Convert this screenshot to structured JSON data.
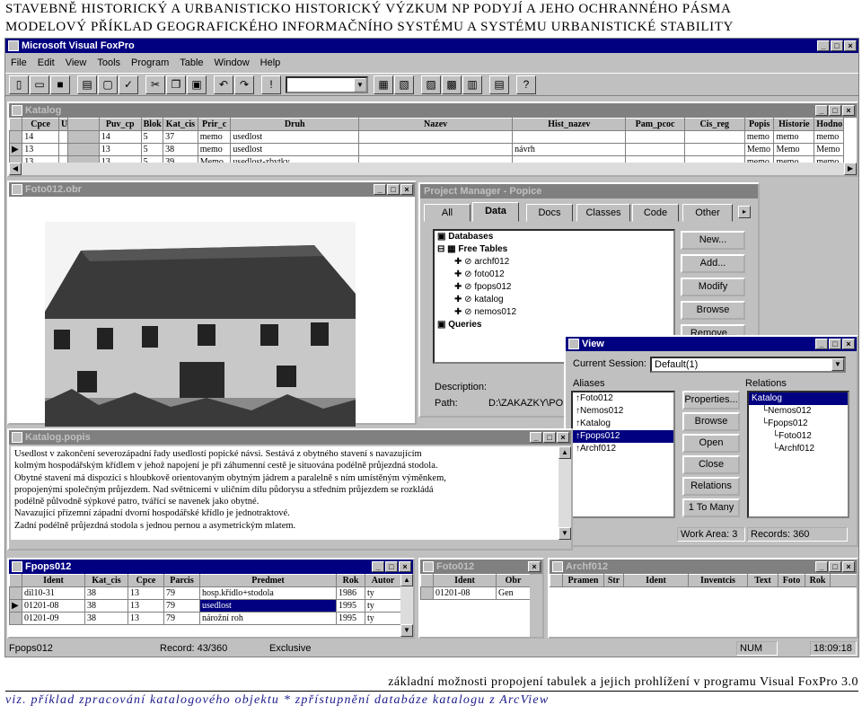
{
  "header": {
    "line1": "STAVEBNĚ HISTORICKÝ A URBANISTICKO HISTORICKÝ VÝZKUM NP PODYJÍ A JEHO OCHRANNÉHO PÁSMA",
    "line2": "MODELOVÝ PŘÍKLAD GEOGRAFICKÉHO INFORMAČNÍHO SYSTÉMU A SYSTÉMU URBANISTICKÉ STABILITY"
  },
  "app": {
    "title": "Microsoft Visual FoxPro"
  },
  "menu": [
    "File",
    "Edit",
    "View",
    "Tools",
    "Program",
    "Table",
    "Window",
    "Help"
  ],
  "katalog": {
    "title": "Katalog",
    "columns": [
      "Cpce",
      "U",
      "Puv_cp",
      "Blok",
      "Kat_cis",
      "Prir_c",
      "Druh",
      "Nazev",
      "Hist_nazev",
      "Pam_pcoc",
      "Cis_reg",
      "Popis",
      "Historie",
      "Hodno"
    ],
    "rows": [
      [
        "14",
        "",
        "14",
        "5",
        "37",
        "memo",
        "usedlost",
        "",
        "",
        "",
        "",
        "memo",
        "memo",
        "memo"
      ],
      [
        "13",
        "",
        "13",
        "5",
        "38",
        "memo",
        "usedlost",
        "",
        "návrh",
        "",
        "",
        "Memo",
        "Memo",
        "Memo"
      ],
      [
        "13",
        "",
        "13",
        "5",
        "39",
        "Memo",
        "usedlost-zbytky",
        "",
        "",
        "",
        "",
        "memo",
        "memo",
        "memo"
      ]
    ]
  },
  "foto": {
    "title": "Foto012.obr"
  },
  "project": {
    "title": "Project Manager - Popice",
    "tabs": [
      "All",
      "Data",
      "Docs",
      "Classes",
      "Code",
      "Other"
    ],
    "tree": [
      "Databases",
      "Free Tables",
      "archf012",
      "foto012",
      "fpops012",
      "katalog",
      "nemos012",
      "Queries"
    ],
    "buttons": [
      "New...",
      "Add...",
      "Modify",
      "Browse",
      "Remove..."
    ],
    "description_label": "Description:",
    "path_label": "Path:",
    "path_value": "D:\\ZAKAZKY\\POD"
  },
  "view": {
    "title": "View",
    "session_label": "Current Session:",
    "session_value": "Default(1)",
    "aliases_label": "Aliases",
    "relations_label": "Relations",
    "aliases": [
      "Foto012",
      "Nemos012",
      "Katalog",
      "Fpops012",
      "Archf012"
    ],
    "buttons": [
      "Properties...",
      "Browse",
      "Open",
      "Close",
      "Relations",
      "1 To Many"
    ],
    "relations": [
      "Katalog",
      "Nemos012",
      "Fpops012",
      "Foto012",
      "Archf012"
    ],
    "work_area": "Work Area: 3",
    "records": "Records: 360"
  },
  "popis": {
    "title": "Katalog.popis",
    "lines": [
      "Usedlost v zakončení severozápadní řady usedlostí popické návsi. Sestává z obytného stavení s navazujícím",
      "kolmým hospodářským křídlem v jehož napojení je při záhumenní cestě je situována podélně průjezdná stodola.",
      "Obytné stavení má dispozici s hloubkově orientovaným obytným jádrem a paralelně s ním umístěným výměnkem,",
      "propojenými společným průjezdem. Nad světnicemi v uličním dílu půdorysu a středním průjezdem se rozkládá",
      "podélně půlvodně sýpkové patro, tvářící se navenek jako obytné.",
      "Navazující přízemní západní dvorní hospodářské křídlo je jednotraktové.",
      "Zadní podélně průjezdná stodola s jednou pernou a asymetrickým mlatem."
    ]
  },
  "fpops": {
    "title": "Fpops012",
    "columns": [
      "Ident",
      "Kat_cis",
      "Cpce",
      "Parcis",
      "Predmet",
      "Rok",
      "Autor"
    ],
    "rows": [
      [
        "dil10-31",
        "38",
        "13",
        "79",
        "hosp.křídlo+stodola",
        "1986",
        "ty"
      ],
      [
        "01201-08",
        "38",
        "13",
        "79",
        "usedlost",
        "1995",
        "ty"
      ],
      [
        "01201-09",
        "38",
        "13",
        "79",
        "nárožní roh",
        "1995",
        "ty"
      ]
    ]
  },
  "foto012": {
    "title": "Foto012",
    "columns": [
      "Ident",
      "Obr"
    ],
    "rows": [
      [
        "01201-08",
        "Gen"
      ]
    ]
  },
  "archf": {
    "title": "Archf012",
    "columns": [
      "Pramen",
      "Str",
      "Ident",
      "Inventcis",
      "Text",
      "Foto",
      "Rok"
    ]
  },
  "status": {
    "alias": "Fpops012",
    "record": "Record: 43/360",
    "mode": "Exclusive",
    "num": "NUM",
    "time": "18:09:18"
  },
  "caption": "základní možnosti propojení tabulek a jejich prohlížení v programu Visual FoxPro 3.0",
  "footnote": "viz. příklad zpracování katalogového objektu * zpřístupnění databáze katalogu z ArcView"
}
